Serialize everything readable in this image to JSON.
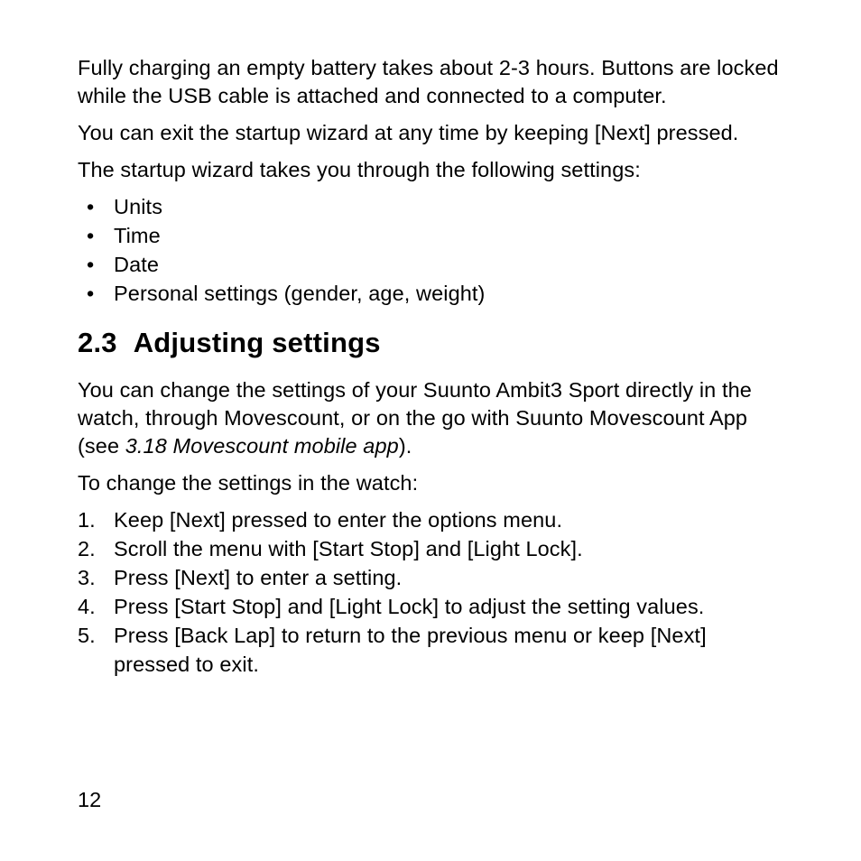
{
  "paragraphs": {
    "p1": "Fully charging an empty battery takes about 2-3 hours. Buttons are locked while the USB cable is attached and connected to a computer.",
    "p2": "You can exit the startup wizard at any time by keeping [Next] pressed.",
    "p3": "The startup wizard takes you through the following settings:"
  },
  "bullet_list": [
    "Units",
    "Time",
    "Date",
    "Personal settings (gender, age, weight)"
  ],
  "heading": {
    "number": "2.3",
    "title": "Adjusting settings"
  },
  "section": {
    "intro_pre": "You can change the settings of your Suunto Ambit3 Sport directly in the watch, through Movescount, or on the go with Suunto Movescount App (see ",
    "intro_ref": "3.18 Movescount mobile app",
    "intro_post": ").",
    "lead": "To change the settings in the watch:"
  },
  "steps": [
    "Keep [Next] pressed to enter the options menu.",
    "Scroll the menu with [Start Stop] and [Light Lock].",
    "Press [Next] to enter a setting.",
    "Press [Start Stop] and [Light Lock] to adjust the setting values.",
    "Press [Back Lap] to return to the previous menu or keep [Next] pressed to exit."
  ],
  "page_number": "12"
}
